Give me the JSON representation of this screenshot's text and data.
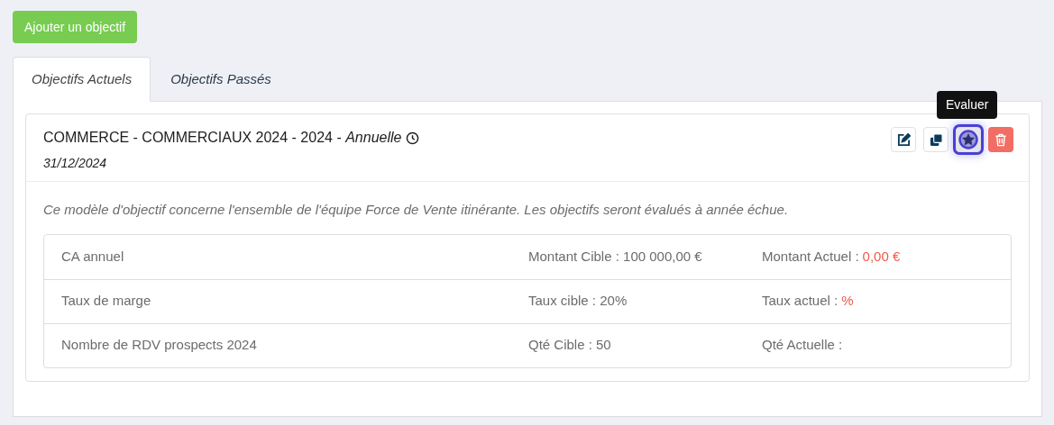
{
  "add_button": "Ajouter un objectif",
  "tabs": [
    {
      "label": "Objectifs Actuels",
      "selected": true
    },
    {
      "label": "Objectifs Passés",
      "selected": false
    }
  ],
  "objective": {
    "title": "COMMERCE - COMMERCIAUX 2024 - 2024 - *Annuelle*",
    "date": "31/12/2024",
    "actions": [
      {
        "kind": "edit",
        "focused": false
      },
      {
        "kind": "duplicate",
        "focused": false
      },
      {
        "kind": "evaluate",
        "focused": true,
        "tooltip": "Evaluer"
      },
      {
        "kind": "delete",
        "focused": false
      }
    ],
    "description": "Ce modèle d'objectif concerne l'ensemble de l'équipe Force de Vente itinérante. Les objectifs seront évalués à année échue.",
    "rows": [
      {
        "label": "CA annuel",
        "target": "Montant Cible : 100 000,00 €",
        "actual_label": "Montant Actuel :",
        "actual_value": "0,00 €"
      },
      {
        "label": "Taux de marge",
        "target": "Taux cible : 20%",
        "actual_label": "Taux actuel :",
        "actual_value": "%"
      },
      {
        "label": "Nombre de RDV prospects 2024",
        "target": "Qté Cible : 50",
        "actual_label": "Qté Actuelle :"
      }
    ]
  }
}
